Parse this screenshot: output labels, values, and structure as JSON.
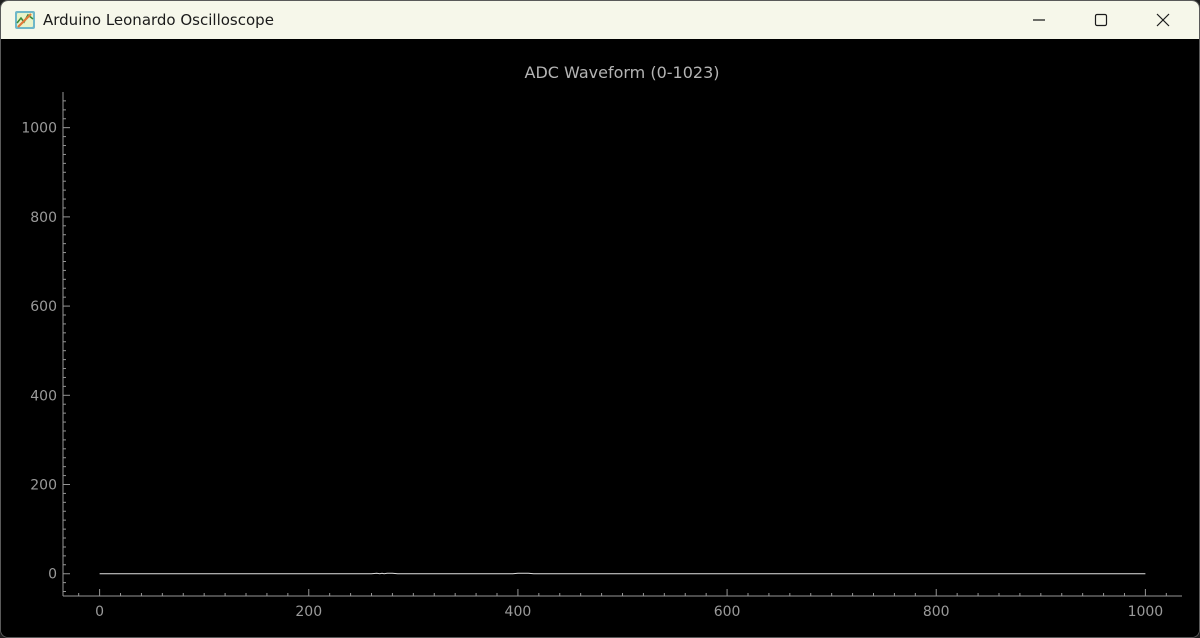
{
  "window": {
    "title": "Arduino Leonardo Oscilloscope",
    "app_icon": "waveform-app-icon",
    "controls": {
      "minimize": "minimize-icon",
      "maximize": "maximize-icon",
      "close": "close-icon"
    }
  },
  "colors": {
    "titlebar_bg": "#f6f7ea",
    "plot_bg": "#000000",
    "axis": "#969696",
    "trace": "#e0e0e0"
  },
  "chart_data": {
    "type": "line",
    "title": "ADC Waveform (0-1023)",
    "xlabel": "",
    "ylabel": "",
    "xlim": [
      -35,
      1035
    ],
    "ylim": [
      -50,
      1080
    ],
    "x_ticks": [
      0,
      200,
      400,
      600,
      800,
      1000
    ],
    "y_ticks": [
      0,
      200,
      400,
      600,
      800,
      1000
    ],
    "grid": false,
    "series": [
      {
        "x": [
          0,
          260,
          265,
          268,
          270,
          272,
          275,
          280,
          285,
          290,
          295,
          300,
          395,
          400,
          405,
          410,
          415,
          420,
          1000
        ],
        "y": [
          0,
          0,
          1,
          0,
          1,
          0,
          1,
          1,
          0,
          0,
          0,
          0,
          0,
          1,
          1,
          1,
          0,
          0,
          0
        ]
      }
    ]
  }
}
